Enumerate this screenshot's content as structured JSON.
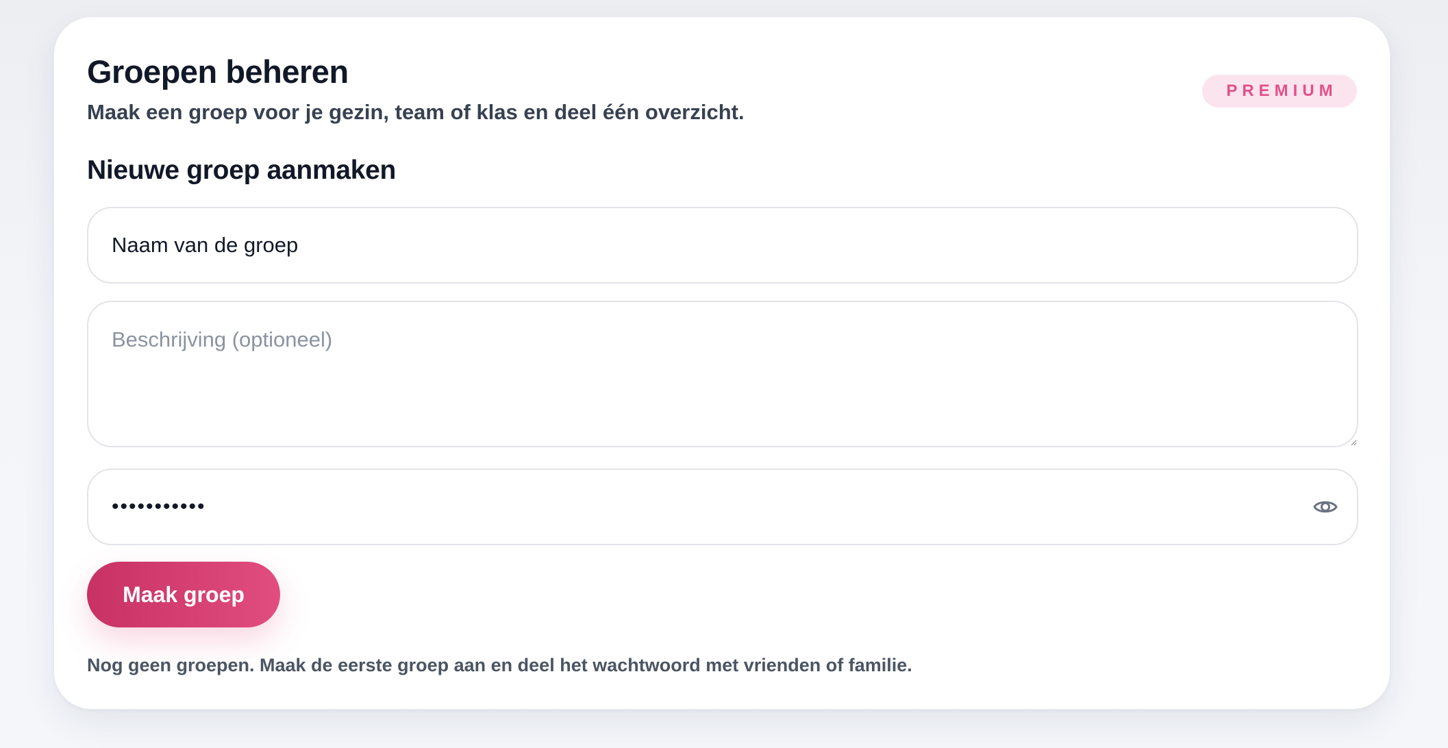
{
  "header": {
    "title": "Groepen beheren",
    "subtitle": "Maak een groep voor je gezin, team of klas en deel één overzicht.",
    "badge": "PREMIUM"
  },
  "form": {
    "section_title": "Nieuwe groep aanmaken",
    "name_value": "Naam van de groep",
    "description_placeholder": "Beschrijving (optioneel)",
    "password_value": "wachtwoord1",
    "password_icon": "eye-icon",
    "submit_label": "Maak groep"
  },
  "groups": {
    "empty_message": "Nog geen groepen. Maak de eerste groep aan en deel het wachtwoord met vrienden of familie."
  },
  "colors": {
    "accent": "#e24d80",
    "accent_dark": "#c73163",
    "badge_background": "#fce4ef",
    "title_text": "#111827",
    "muted_text": "#4b5563"
  }
}
